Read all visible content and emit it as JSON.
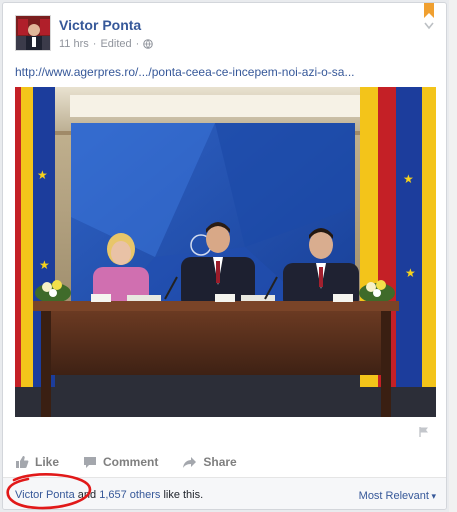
{
  "post": {
    "author": "Victor Ponta",
    "time": "11 hrs",
    "separator": "·",
    "edited": "Edited",
    "link_text": "http://www.agerpres.ro/.../ponta-ceea-ce-incepem-noi-azi-o-sa...",
    "photo": {
      "icons": [
        "bookmark-icon",
        "chevron-down-icon",
        "globe-icon",
        "flag-icon"
      ]
    }
  },
  "actions": {
    "like": "Like",
    "comment": "Comment",
    "share": "Share"
  },
  "likes": {
    "name": "Victor Ponta",
    "connector": "and",
    "others": "1,657 others",
    "suffix": "like this.",
    "sort": "Most Relevant"
  },
  "colors": {
    "link": "#365899",
    "annotation": "#e11919"
  }
}
